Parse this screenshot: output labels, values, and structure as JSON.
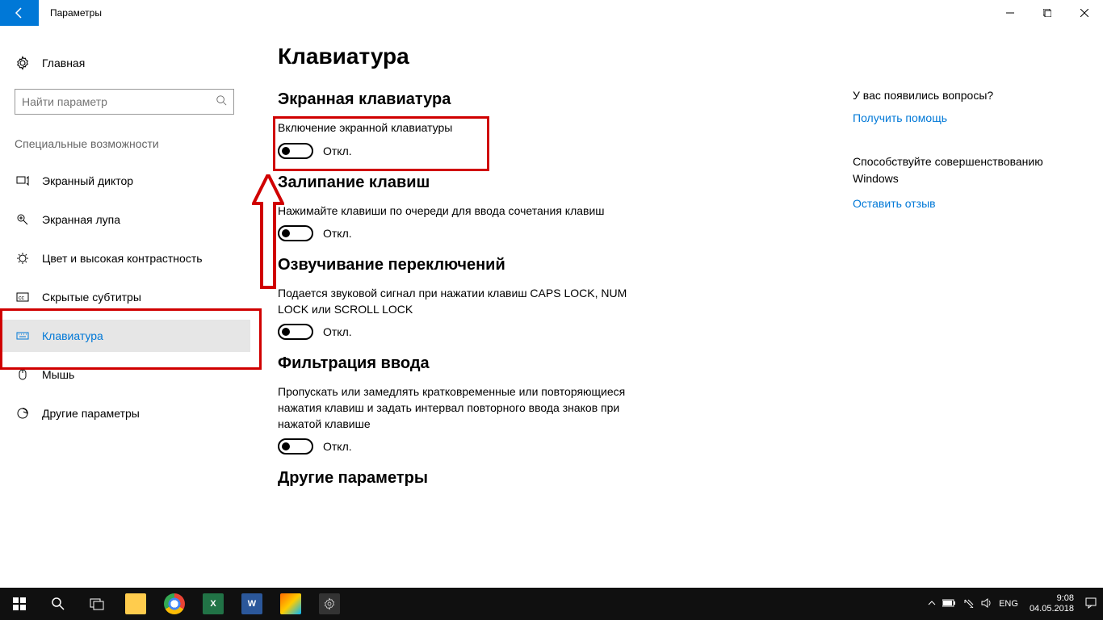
{
  "window": {
    "title": "Параметры"
  },
  "sidebar": {
    "home": "Главная",
    "search_placeholder": "Найти параметр",
    "group_title": "Специальные возможности",
    "items": [
      {
        "label": "Экранный диктор"
      },
      {
        "label": "Экранная лупа"
      },
      {
        "label": "Цвет и высокая контрастность"
      },
      {
        "label": "Скрытые субтитры"
      },
      {
        "label": "Клавиатура"
      },
      {
        "label": "Мышь"
      },
      {
        "label": "Другие параметры"
      }
    ]
  },
  "main": {
    "title": "Клавиатура",
    "sections": {
      "onscreen": {
        "title": "Экранная клавиатура",
        "desc": "Включение экранной клавиатуры",
        "state": "Откл."
      },
      "sticky": {
        "title": "Залипание клавиш",
        "desc": "Нажимайте клавиши по очереди для ввода сочетания клавиш",
        "state": "Откл."
      },
      "toggle_keys": {
        "title": "Озвучивание переключений",
        "desc": "Подается звуковой сигнал при нажатии клавиш CAPS LOCK, NUM LOCK или SCROLL LOCK",
        "state": "Откл."
      },
      "filter": {
        "title": "Фильтрация ввода",
        "desc": "Пропускать или замедлять кратковременные или повторяющиеся нажатия клавиш и задать интервал повторного ввода знаков при нажатой клавише",
        "state": "Откл."
      },
      "other": {
        "title": "Другие параметры"
      }
    }
  },
  "right": {
    "q_heading": "У вас появились вопросы?",
    "help_link": "Получить помощь",
    "improve_text": "Способствуйте совершенствованию Windows",
    "feedback_link": "Оставить отзыв"
  },
  "taskbar": {
    "lang": "ENG",
    "time": "9:08",
    "date": "04.05.2018"
  }
}
